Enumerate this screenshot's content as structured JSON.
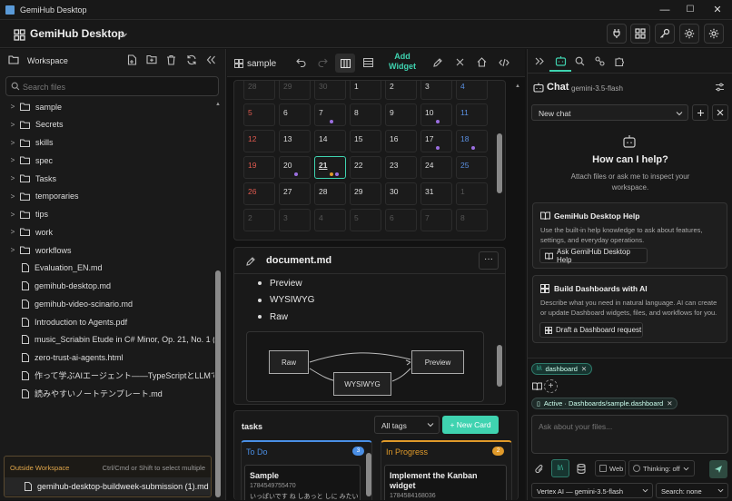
{
  "window": {
    "title": "GemiHub Desktop",
    "min": "—",
    "max": "☐",
    "close": "✕"
  },
  "app": {
    "title": "GemiHub Desktop"
  },
  "left": {
    "workspace_label": "Workspace",
    "search_placeholder": "Search files",
    "tree": [
      {
        "type": "folder",
        "name": "sample"
      },
      {
        "type": "folder",
        "name": "Secrets"
      },
      {
        "type": "folder",
        "name": "skills"
      },
      {
        "type": "folder",
        "name": "spec"
      },
      {
        "type": "folder",
        "name": "Tasks"
      },
      {
        "type": "folder",
        "name": "temporaries"
      },
      {
        "type": "folder",
        "name": "tips"
      },
      {
        "type": "folder",
        "name": "work"
      },
      {
        "type": "folder",
        "name": "workflows"
      },
      {
        "type": "file",
        "name": "Evaluation_EN.md"
      },
      {
        "type": "file",
        "name": "gemihub-desktop.md"
      },
      {
        "type": "file",
        "name": "gemihub-video-scinario.md"
      },
      {
        "type": "file",
        "name": "Introduction to Agents.pdf"
      },
      {
        "type": "file",
        "name": "music_Scriabin Etude in C# Minor, Op. 21, No. 1 (..."
      },
      {
        "type": "file",
        "name": "zero-trust-ai-agents.html"
      },
      {
        "type": "file",
        "name": "作って学ぶAIエージェント——TypeScriptとLLMで切り..."
      },
      {
        "type": "file",
        "name": "読みやすいノートテンプレート.md"
      }
    ],
    "outside": {
      "label": "Outside Workspace",
      "hint": "Ctrl/Cmd or Shift to select multiple",
      "file": "gemihub-desktop-buildweek-submission (1).md"
    }
  },
  "middle": {
    "dashboard_name": "sample",
    "add_widget_label": "Add\nWidget",
    "calendar": [
      [
        "28",
        "29",
        "30",
        "1",
        "2",
        "3",
        "4"
      ],
      [
        "5",
        "6",
        "7",
        "8",
        "9",
        "10",
        "11"
      ],
      [
        "12",
        "13",
        "14",
        "15",
        "16",
        "17",
        "18"
      ],
      [
        "19",
        "20",
        "21",
        "22",
        "23",
        "24",
        "25"
      ],
      [
        "26",
        "27",
        "28",
        "29",
        "30",
        "31",
        "1"
      ],
      [
        "2",
        "3",
        "4",
        "5",
        "6",
        "7",
        "8"
      ]
    ],
    "document": {
      "title": "document.md",
      "bullets": [
        "Preview",
        "WYSIWYG",
        "Raw"
      ],
      "diagram": {
        "raw": "Raw",
        "wysiwyg": "WYSIWYG",
        "preview": "Preview"
      }
    },
    "tasks": {
      "title": "tasks",
      "filter": "All tags",
      "new_card": "+ New Card",
      "columns": [
        {
          "name": "To Do",
          "count": "3",
          "color": "#4a8fe6",
          "card_title": "Sample",
          "card_id": "1784549755470",
          "card_text": "いっぱいです ね しあっと しに みたい"
        },
        {
          "name": "In Progress",
          "count": "2",
          "color": "#e09a2a",
          "card_title": "Implement the Kanban widget",
          "card_id": "1784584168036"
        }
      ]
    }
  },
  "right": {
    "chat_title": "Chat",
    "model": "gemini-3.5-flash",
    "select_value": "New chat",
    "help_title": "How can I help?",
    "help_sub": "Attach files or ask me to inspect your workspace.",
    "card1": {
      "title": "GemiHub Desktop Help",
      "desc": "Use the built-in help knowledge to ask about features, settings, and everyday operations.",
      "button": "Ask GemiHub Desktop Help"
    },
    "card2": {
      "title": "Build Dashboards with AI",
      "desc": "Describe what you need in natural language. AI can create or update Dashboard widgets, files, and workflows for you.",
      "button": "Draft a Dashboard request"
    },
    "chip1": "dashboard",
    "chip2": "Active · Dashboards/sample.dashboard",
    "input_placeholder": "Ask about your files...",
    "web_label": "Web",
    "thinking_label": "Thinking: off",
    "model_select": "Vertex AI — gemini-3.5-flash",
    "search_select": "Search: none"
  },
  "colors": {
    "accent": "#3fd3b0",
    "sunday": "#e05a4f",
    "saturday": "#5a8fe0",
    "event_dot": "#9b6fe0",
    "event_dot2": "#e09a2a"
  }
}
